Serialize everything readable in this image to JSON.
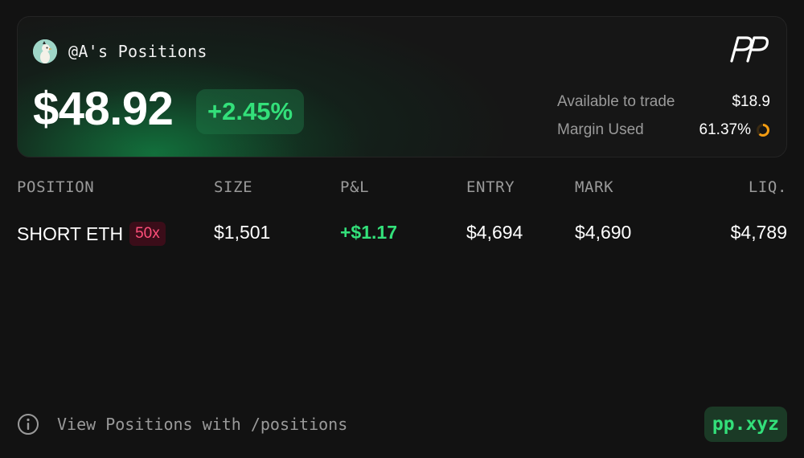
{
  "header": {
    "title": "@A's Positions",
    "balance": "$48.92",
    "change": "+2.45%",
    "avatar_icon": "bird-avatar-icon",
    "logo_icon": "pp-logo-icon"
  },
  "stats": {
    "available_label": "Available to trade",
    "available_value": "$18.9",
    "margin_label": "Margin Used",
    "margin_value": "61.37%",
    "margin_fraction": 0.6137,
    "ring_color": "#f39c12"
  },
  "table": {
    "columns": [
      "POSITION",
      "SIZE",
      "P&L",
      "ENTRY",
      "MARK",
      "LIQ."
    ],
    "rows": [
      {
        "position": "SHORT ETH",
        "leverage": "50x",
        "size": "$1,501",
        "pnl": "+$1.17",
        "entry": "$4,694",
        "mark": "$4,690",
        "liq": "$4,789"
      }
    ]
  },
  "footer": {
    "hint": "View Positions with /positions",
    "site": "pp.xyz"
  },
  "colors": {
    "accent_green": "#33e07a",
    "danger_pink": "#ff4f7a",
    "background": "#121212"
  }
}
